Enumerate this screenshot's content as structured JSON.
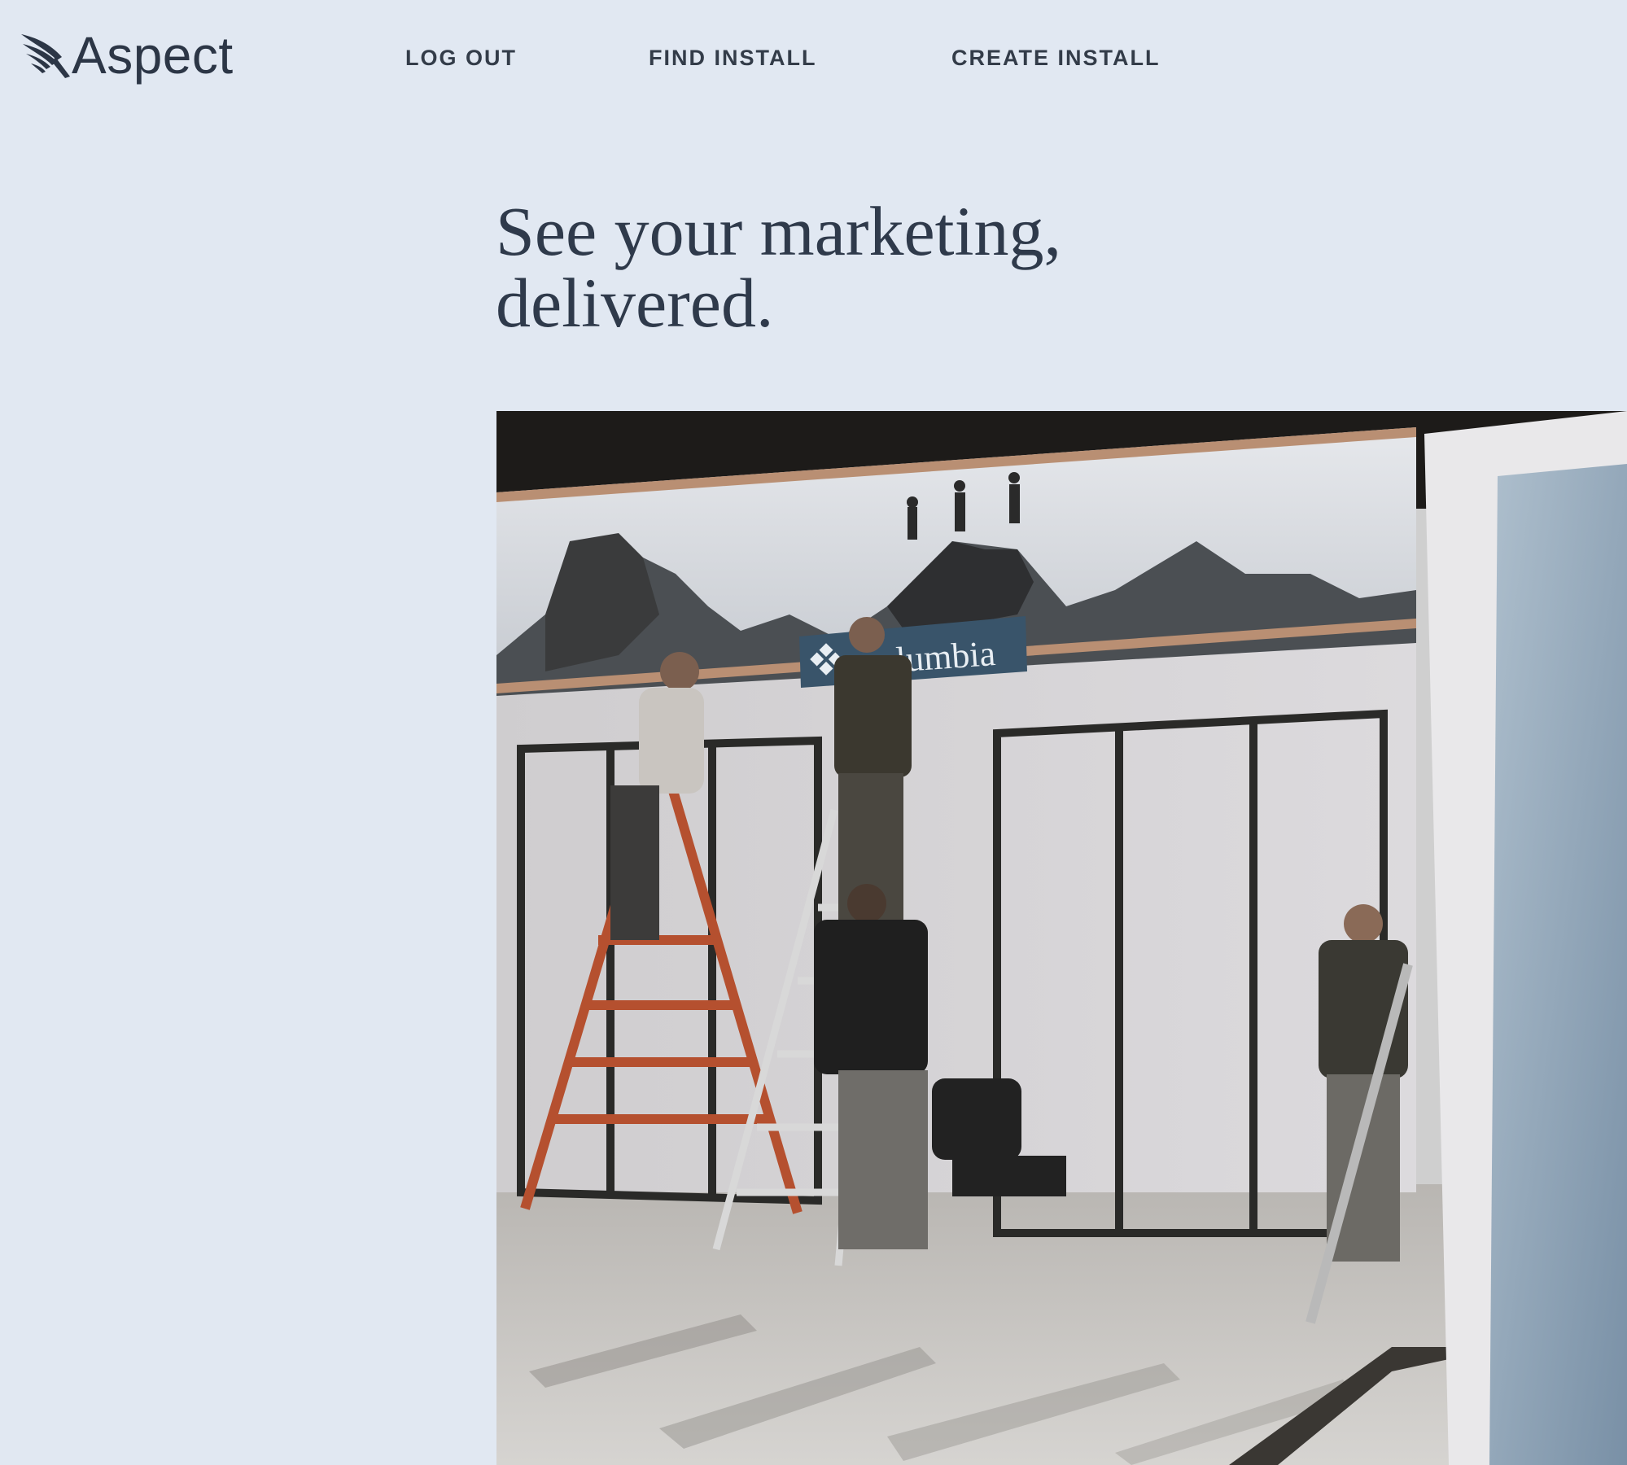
{
  "brand": {
    "name": "Aspect",
    "logo_icon": "wing-icon"
  },
  "nav": {
    "items": [
      {
        "label": "LOG OUT",
        "name": "nav-log-out"
      },
      {
        "label": "FIND INSTALL",
        "name": "nav-find-install"
      },
      {
        "label": "CREATE INSTALL",
        "name": "nav-create-install"
      }
    ]
  },
  "hero": {
    "headline_line1": "See your marketing,",
    "headline_line2": "delivered.",
    "image_sign_text": "olumbia"
  },
  "colors": {
    "background": "#e1e8f2",
    "text": "#2c3646"
  }
}
